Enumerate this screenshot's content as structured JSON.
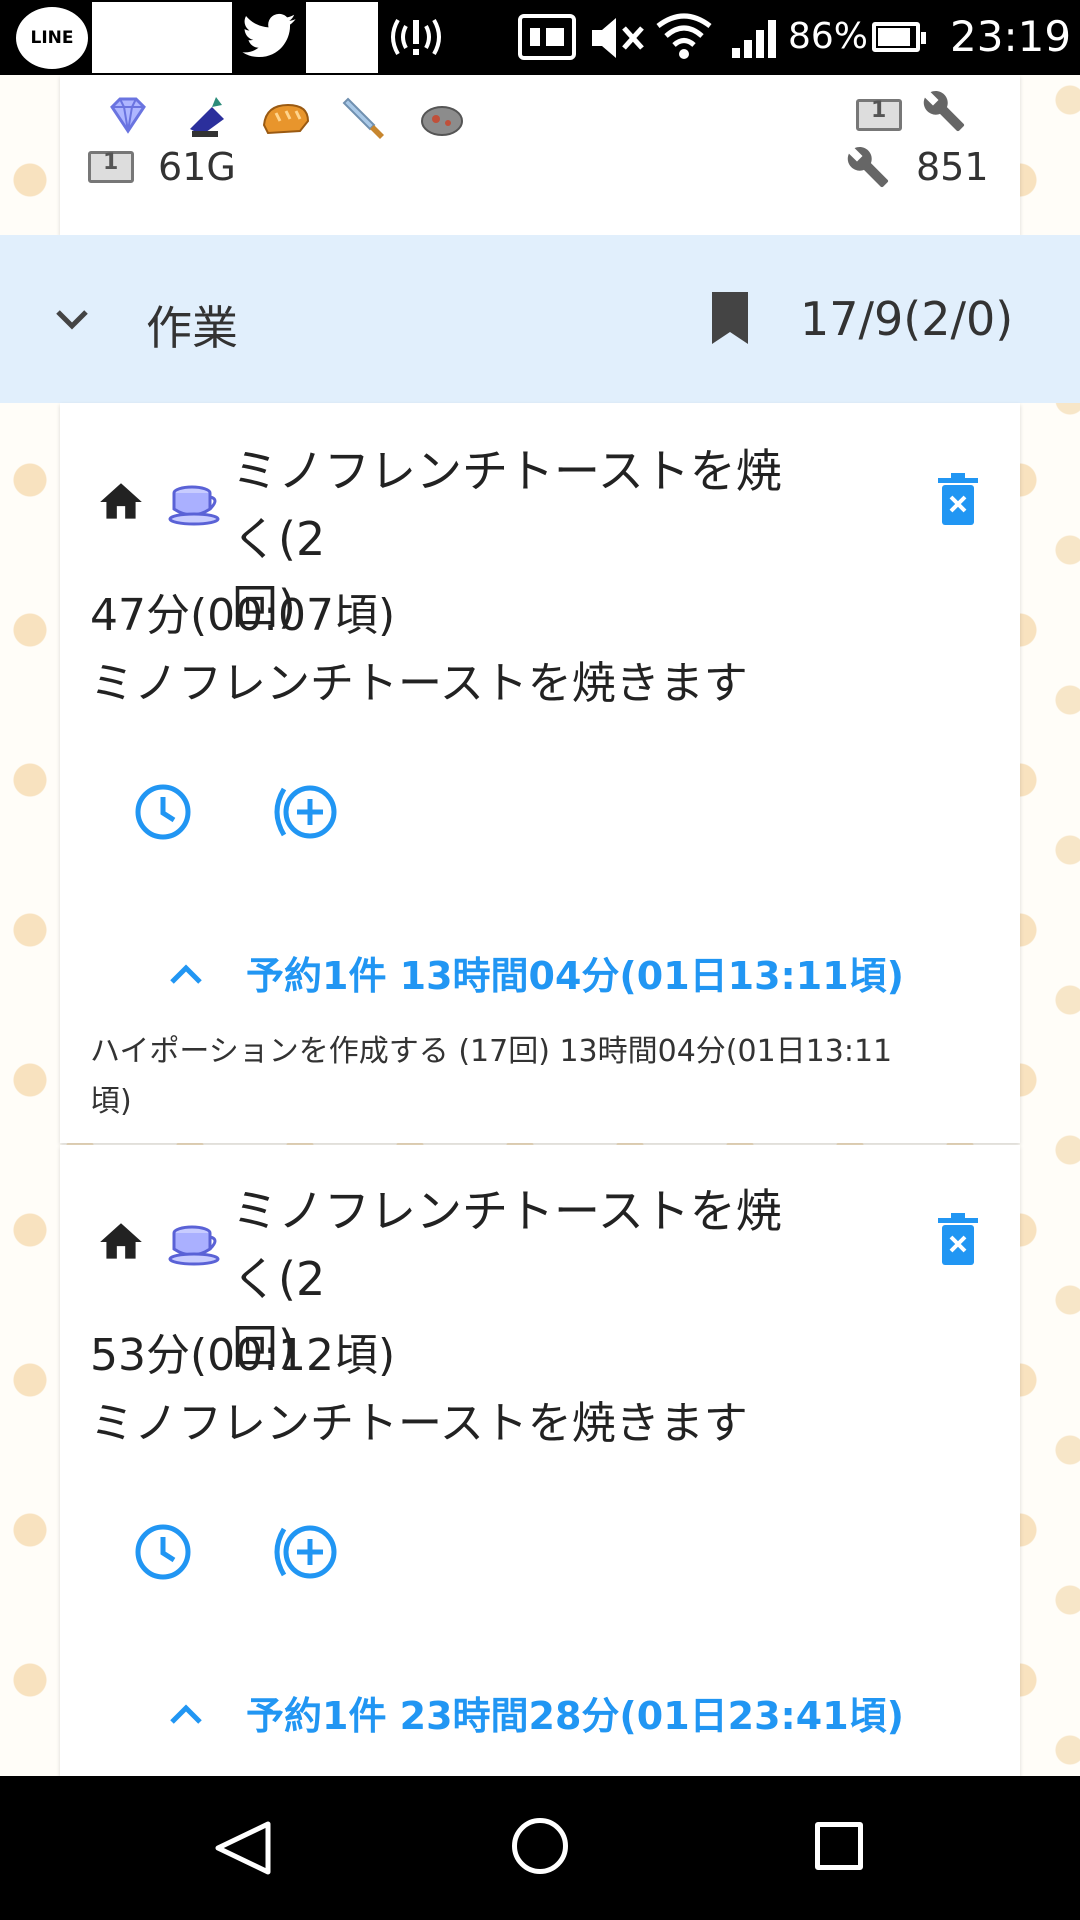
{
  "statusbar": {
    "line_label": "LINE",
    "battery_pct": "86%",
    "time": "23:19"
  },
  "resources": {
    "money": "61G",
    "tools": "851",
    "items": [
      "gem-icon",
      "ink-bottle-icon",
      "bread-icon",
      "knife-icon",
      "stone-icon"
    ]
  },
  "section": {
    "title": "作業",
    "count": "17/9(2/0)"
  },
  "tasks": [
    {
      "title_line1": "ミノフレンチトーストを焼く(2",
      "title_line2": "回)",
      "time": "47分(00:07頃)",
      "desc": "ミノフレンチトーストを焼きます",
      "reservation": "予約1件 13時間04分(01日13:11頃)",
      "detail_line1": "ハイポーションを作成する (17回) 13時間04分(01日13:11",
      "detail_line2": "頃)"
    },
    {
      "title_line1": "ミノフレンチトーストを焼く(2",
      "title_line2": "回)",
      "time": "53分(00:12頃)",
      "desc": "ミノフレンチトーストを焼きます",
      "reservation": "予約1件 23時間28分(01日23:41頃)"
    }
  ],
  "colors": {
    "accent": "#2196f3",
    "header_bg": "#e1effc"
  }
}
